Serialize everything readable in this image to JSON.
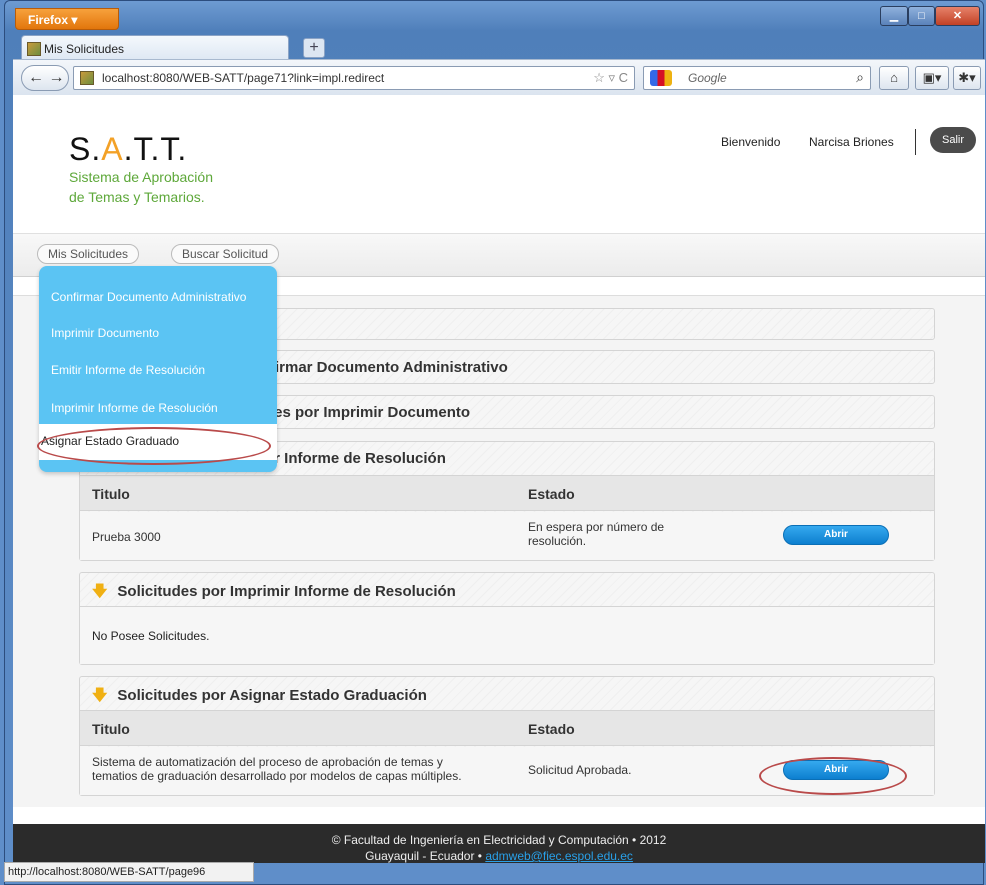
{
  "browser": {
    "menu_label": "Firefox ▾",
    "tab_title": "Mis Solicitudes",
    "new_tab": "+",
    "back": "←  →",
    "url": "localhost:8080/WEB-SATT/page71?link=impl.redirect",
    "url_tail": "☆ ▿ C",
    "search_placeholder": "Google",
    "search_icon": "magnifier-icon",
    "status_url": "http://localhost:8080/WEB-SATT/page96"
  },
  "header": {
    "logo_s": "S.",
    "logo_a": "A",
    "logo_rest": ".T.T.",
    "subtitle_1": "Sistema de Aprobación",
    "subtitle_2": "de Temas y Temarios.",
    "welcome": "Bienvenido",
    "user": "Narcisa Briones",
    "logout": "Salir"
  },
  "menu": {
    "mis_solicitudes": "Mis Solicitudes",
    "buscar": "Buscar Solicitud",
    "dropdown": [
      "Confirmar Documento Administrativo",
      "Imprimir Documento",
      "Emitir Informe de Resolución",
      "Imprimir Informe de Resolución",
      "Asignar Estado Graduado"
    ]
  },
  "panels": {
    "p2_title": "firmar Documento Administrativo",
    "p3_title": "les por Imprimir Documento",
    "p4_title": "ir Informe de Resolución",
    "col_titulo": "Titulo",
    "col_estado": "Estado",
    "p4_row_title": "Prueba 3000",
    "p4_row_estado_1": "En espera por número de",
    "p4_row_estado_2": "resolución.",
    "open": "Abrir",
    "p5_title": "Solicitudes por Imprimir Informe de Resolución",
    "p5_empty": "No Posee Solicitudes.",
    "p6_title": "Solicitudes por Asignar Estado Graduación",
    "p6_row_title_1": "Sistema de automatización del proceso de aprobación de temas y",
    "p6_row_title_2": "tematios de graduación desarrollado por modelos de capas múltiples.",
    "p6_row_estado": "Solicitud Aprobada."
  },
  "footer": {
    "line1": "© Facultad de Ingeniería en Electricidad y Computación • 2012",
    "line2": "Guayaquil - Ecuador • ",
    "email": "admweb@fiec.espol.edu.ec"
  },
  "colors": {
    "accent": "#5bc4f3",
    "button": "#1a8ed8",
    "highlight_ring": "#b94a4a",
    "logo_a": "#f3a127",
    "subtitle": "#5ea83a"
  }
}
